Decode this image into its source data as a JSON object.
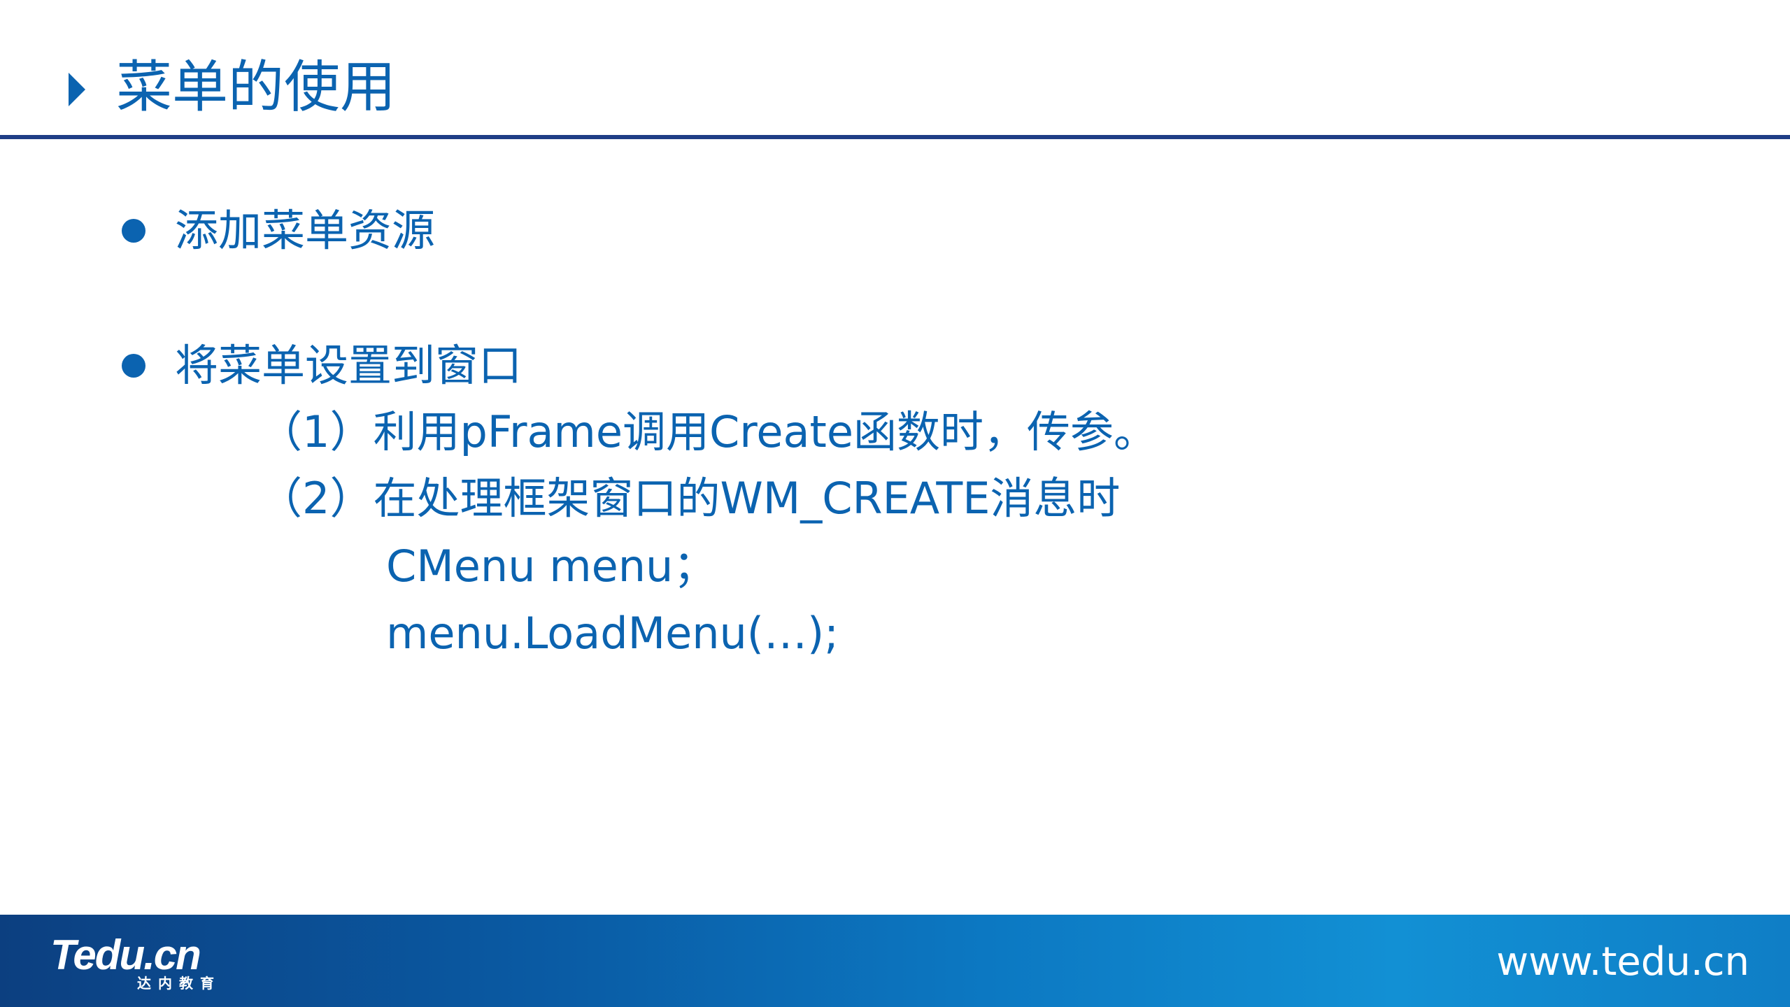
{
  "slide": {
    "title": "菜单的使用",
    "bullets": [
      {
        "text": "添加菜单资源"
      },
      {
        "text": "将菜单设置到窗口",
        "sub_items": [
          "（1）利用pFrame调用Create函数时，传参。",
          "（2）在处理框架窗口的WM_CREATE消息时"
        ],
        "code_lines": [
          "CMenu menu；",
          "menu.LoadMenu(…);"
        ]
      }
    ]
  },
  "footer": {
    "logo_text": "Tedu.cn",
    "logo_subtext": "达内教育",
    "url": "www.tedu.cn"
  },
  "colors": {
    "accent": "#0b63b0",
    "rule": "#1f3e86",
    "footer_dark": "#0c3f80",
    "footer_light": "#1290d4"
  },
  "icons": {
    "title_marker": "triangle-right-icon",
    "bullet": "circle-bullet-icon"
  }
}
